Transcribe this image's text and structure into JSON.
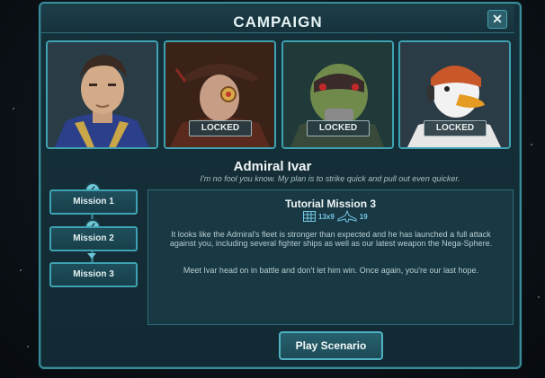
{
  "window": {
    "title": "CAMPAIGN",
    "close_label": "✕"
  },
  "portraits": [
    {
      "name": "admiral-portrait",
      "locked": false,
      "badge": ""
    },
    {
      "name": "pirate-portrait",
      "locked": true,
      "badge": "LOCKED"
    },
    {
      "name": "alien-portrait",
      "locked": true,
      "badge": "LOCKED"
    },
    {
      "name": "duck-pilot-portrait",
      "locked": true,
      "badge": "LOCKED"
    }
  ],
  "hero": {
    "name": "Admiral Ivar",
    "quote": "I'm no fool you know. My plan is to strike quick and pull out even quicker."
  },
  "missions": [
    {
      "label": "Mission 1",
      "completed": true
    },
    {
      "label": "Mission 2",
      "completed": true
    },
    {
      "label": "Mission 3",
      "completed": false
    }
  ],
  "detail": {
    "title": "Tutorial Mission 3",
    "map_size": "13x9",
    "ship_count": "19",
    "paragraph1": "It looks like the Admiral's fleet is stronger than expected and he has launched a full attack against you, including several fighter ships as well as our latest weapon the Nega-Sphere.",
    "paragraph2": "Meet Ivar head on in battle and don't let him win. Once again, you're our last hope."
  },
  "play_button": "Play Scenario",
  "icons": {
    "map": "grid-map-icon",
    "ships": "fighter-ship-icon",
    "check": "checkmark-icon"
  },
  "colors": {
    "accent": "#3ea2b2",
    "panel": "#15303a",
    "text": "#e6f2f3"
  }
}
